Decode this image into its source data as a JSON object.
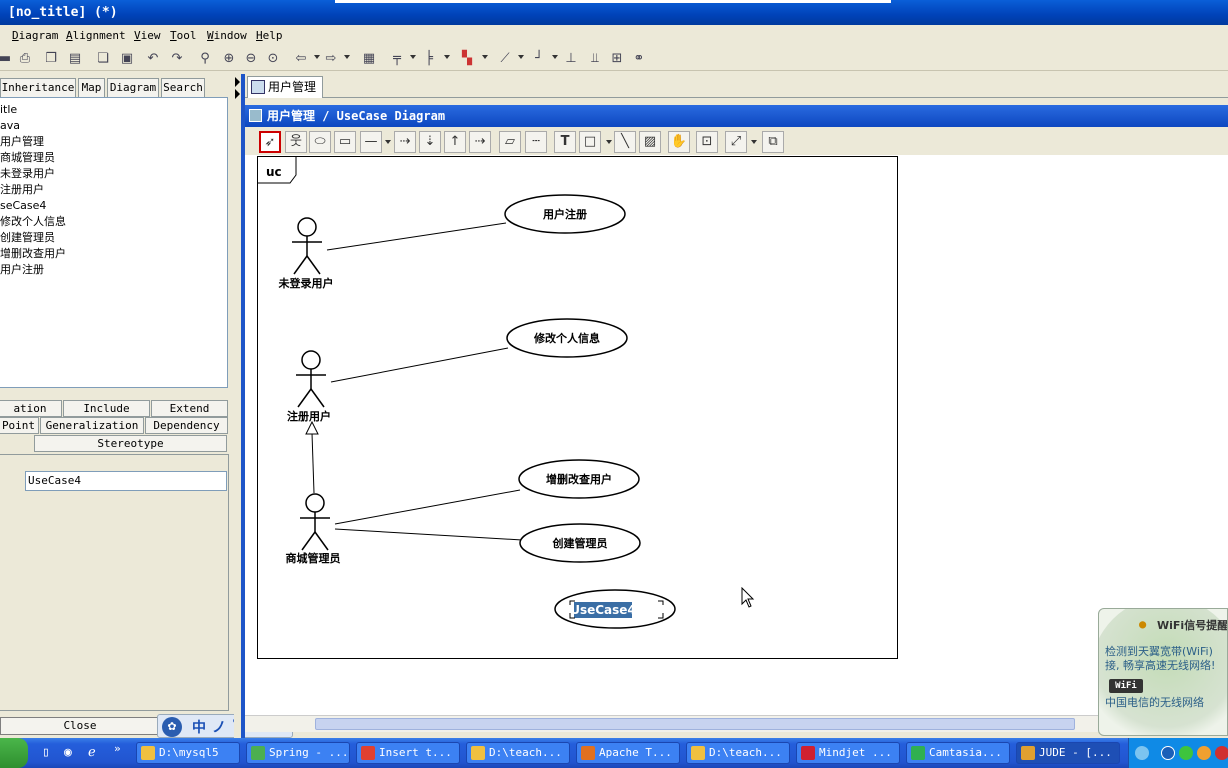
{
  "window": {
    "title": "[no_title] (*)"
  },
  "menu": [
    "Diagram",
    "Alignment",
    "View",
    "Tool",
    "Window",
    "Help"
  ],
  "left_panel": {
    "tabs": [
      "Inheritance",
      "Map",
      "Diagram",
      "Search"
    ],
    "tree": [
      "itle",
      "ava",
      "用户管理",
      "商城管理员",
      "未登录用户",
      "注册用户",
      "seCase4",
      "修改个人信息",
      "创建管理员",
      "增删改查用户",
      "用户注册"
    ],
    "prop_tabs_row1": [
      "ation",
      "Include",
      "Extend"
    ],
    "prop_tabs_row2": [
      "Point",
      "Generalization",
      "Dependency"
    ],
    "prop_tabs_row3": [
      "Stereotype"
    ],
    "name_value": "UseCase4",
    "close_label": "Close"
  },
  "ime": {
    "chars": [
      "中",
      "ノ",
      "°,",
      "⌨",
      "⚙"
    ]
  },
  "document": {
    "tab_label": "用户管理",
    "diagram_title": "用户管理 / UseCase Diagram",
    "frame_label": "uc"
  },
  "diagram": {
    "actors": [
      {
        "name": "未登录用户"
      },
      {
        "name": "注册用户"
      },
      {
        "name": "商城管理员"
      }
    ],
    "usecases": [
      {
        "name": "用户注册"
      },
      {
        "name": "修改个人信息"
      },
      {
        "name": "增删改查用户"
      },
      {
        "name": "创建管理员"
      },
      {
        "name": "UseCase4",
        "selected": true
      }
    ]
  },
  "wifi_popup": {
    "title": "WiFi信号提醒",
    "line1": "检测到天翼宽带(WiFi)",
    "line2": "接, 畅享高速无线网络!",
    "logo": "WiFi",
    "line3": "中国电信的无线网络"
  },
  "taskbar": {
    "items": [
      {
        "label": "D:\\mysql5",
        "icon_color": "#f0c040"
      },
      {
        "label": "Spring - ...",
        "icon_color": "#4caf50"
      },
      {
        "label": "Insert t...",
        "icon_color": "#e04030"
      },
      {
        "label": "D:\\teach...",
        "icon_color": "#f0c040"
      },
      {
        "label": "Apache T...",
        "icon_color": "#e07020"
      },
      {
        "label": "D:\\teach...",
        "icon_color": "#f0c040"
      },
      {
        "label": "Mindjet ...",
        "icon_color": "#d02030"
      },
      {
        "label": "Camtasia...",
        "icon_color": "#30b050"
      },
      {
        "label": "JUDE - [...",
        "icon_color": "#e0a030"
      }
    ]
  },
  "colors": {
    "selection_highlight": "#3a6ea5",
    "title_blue": "#0a5fd8"
  }
}
